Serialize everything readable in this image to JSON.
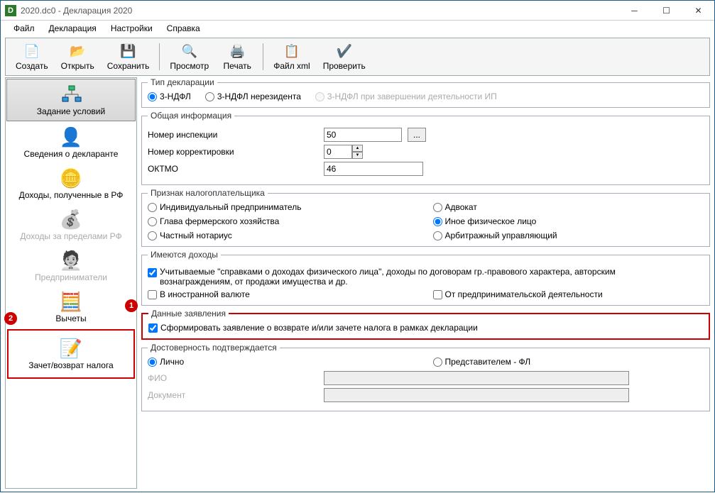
{
  "title": "2020.dc0 - Декларация 2020",
  "menu": {
    "file": "Файл",
    "decl": "Декларация",
    "settings": "Настройки",
    "help": "Справка"
  },
  "toolbar": {
    "create": "Создать",
    "open": "Открыть",
    "save": "Сохранить",
    "preview": "Просмотр",
    "print": "Печать",
    "xml": "Файл xml",
    "check": "Проверить"
  },
  "sidebar": {
    "conditions": "Задание условий",
    "declarant": "Сведения о декларанте",
    "income_rf": "Доходы, полученные в РФ",
    "income_abroad": "Доходы за пределами РФ",
    "entrepreneurs": "Предприниматели",
    "deductions": "Вычеты",
    "refund": "Зачет/возврат налога"
  },
  "declType": {
    "legend": "Тип декларации",
    "opt1": "3-НДФЛ",
    "opt2": "3-НДФЛ нерезидента",
    "opt3": "3-НДФЛ при завершении деятельности ИП"
  },
  "general": {
    "legend": "Общая информация",
    "inspection": "Номер инспекции",
    "inspection_val": "50",
    "correction": "Номер корректировки",
    "correction_val": "0",
    "oktmo": "ОКТМО",
    "oktmo_val": "46"
  },
  "taxpayer": {
    "legend": "Признак налогоплательщика",
    "ip": "Индивидуальный предприниматель",
    "advocate": "Адвокат",
    "farmer": "Глава фермерского хозяйства",
    "other_person": "Иное физическое лицо",
    "notary": "Частный нотариус",
    "arbitr": "Арбитражный управляющий"
  },
  "income": {
    "legend": "Имеются доходы",
    "spravki": "Учитываемые \"справками о доходах физического лица\", доходы по договорам гр.-правового характера, авторским вознаграждениям, от продажи имущества и др.",
    "foreign": "В иностранной валюте",
    "business": "От предпринимательской деятельности"
  },
  "application": {
    "legend": "Данные заявления",
    "form": "Сформировать заявление о  возврате и/или зачете налога в рамках декларации"
  },
  "trust": {
    "legend": "Достоверность подтверждается",
    "personal": "Лично",
    "rep": "Представителем - ФЛ",
    "fio": "ФИО",
    "doc": "Документ"
  },
  "badges": {
    "one": "1",
    "two": "2"
  }
}
